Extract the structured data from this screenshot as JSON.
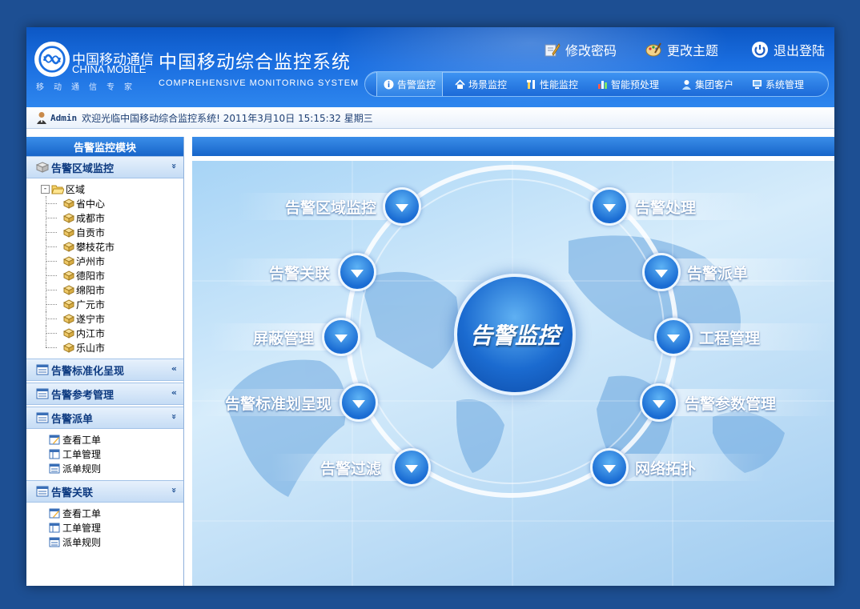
{
  "header": {
    "brand_cn": "中国移动通信",
    "brand_en": "CHINA MOBILE",
    "brand_sub": "移动通信专家",
    "system_title": "中国移动综合监控系统",
    "system_title_en": "COMPREHENSIVE MONITORING SYSTEM",
    "links": {
      "change_password": "修改密码",
      "change_theme": "更改主题",
      "logout": "退出登陆"
    }
  },
  "nav": {
    "items": [
      {
        "label": "告警监控",
        "icon": "info-icon",
        "active": true
      },
      {
        "label": "场景监控",
        "icon": "home-icon"
      },
      {
        "label": "性能监控",
        "icon": "tools-icon"
      },
      {
        "label": "智能预处理",
        "icon": "bar-chart-icon"
      },
      {
        "label": "集团客户",
        "icon": "user-icon"
      },
      {
        "label": "系统管理",
        "icon": "computer-icon"
      }
    ]
  },
  "welcome": {
    "user": "Admin",
    "text": "欢迎光临中国移动综合监控系统! 2011年3月10日 15:15:32 星期三"
  },
  "sidebar": {
    "title": "告警监控模块",
    "sections": [
      {
        "label": "告警区域监控",
        "chevron": "»"
      },
      {
        "label": "告警标准化呈现",
        "chevron": "«"
      },
      {
        "label": "告警参考管理",
        "chevron": "«"
      },
      {
        "label": "告警派单",
        "chevron": "»"
      },
      {
        "label": "告警关联",
        "chevron": "»"
      }
    ],
    "tree": {
      "root": "区域",
      "children": [
        "省中心",
        "成都市",
        "自贡市",
        "攀枝花市",
        "泸州市",
        "德阳市",
        "绵阳市",
        "广元市",
        "遂宁市",
        "内江市",
        "乐山市"
      ]
    },
    "dispatch_items": [
      "查看工单",
      "工单管理",
      "派单规则"
    ],
    "relation_items": [
      "查看工单",
      "工单管理",
      "派单规则"
    ]
  },
  "main": {
    "center_label": "告警监控",
    "modules_left": [
      "告警区域监控",
      "告警关联",
      "屏蔽管理",
      "告警标准划呈现",
      "告警过滤"
    ],
    "modules_right": [
      "告警处理",
      "告警派单",
      "工程管理",
      "告警参数管理",
      "网络拓扑"
    ]
  },
  "colors": {
    "accent": "#1765c9",
    "page_background": "#1d4f93"
  }
}
